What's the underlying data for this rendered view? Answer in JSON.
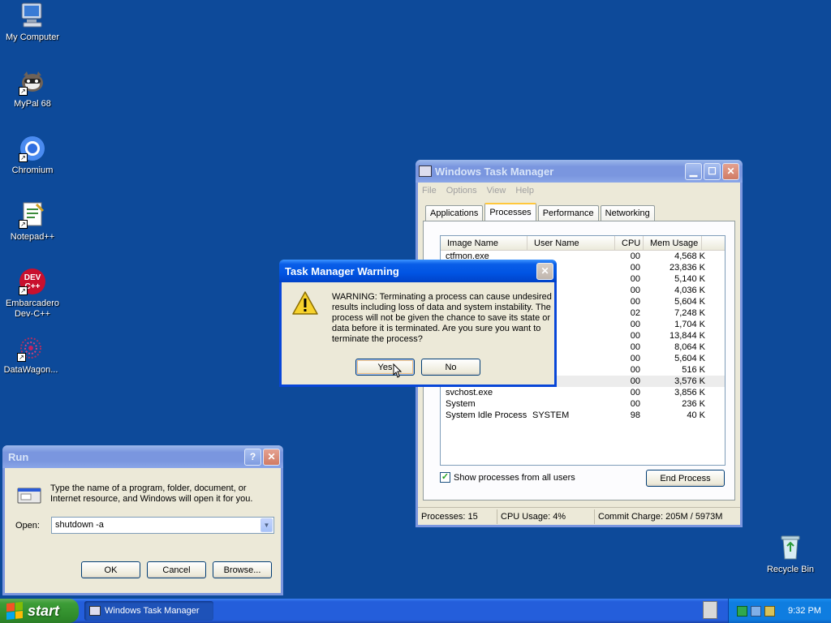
{
  "desktop": {
    "icons": [
      {
        "label": "My Computer"
      },
      {
        "label": "MyPal 68"
      },
      {
        "label": "Chromium"
      },
      {
        "label": "Notepad++"
      },
      {
        "label": "Embarcadero\nDev-C++"
      },
      {
        "label": "DataWagon..."
      },
      {
        "label": "Recycle Bin"
      }
    ]
  },
  "task_manager": {
    "title": "Windows Task Manager",
    "menu": [
      "File",
      "Options",
      "View",
      "Help"
    ],
    "tabs": [
      "Applications",
      "Processes",
      "Performance",
      "Networking"
    ],
    "selected_tab": "Processes",
    "columns": [
      "Image Name",
      "User Name",
      "CPU",
      "Mem Usage"
    ],
    "rows": [
      {
        "name": "ctfmon.exe",
        "user": "",
        "cpu": "00",
        "mem": "4,568 K"
      },
      {
        "name": "",
        "user": "",
        "cpu": "00",
        "mem": "23,836 K"
      },
      {
        "name": "",
        "user": "",
        "cpu": "00",
        "mem": "5,140 K"
      },
      {
        "name": "",
        "user": "",
        "cpu": "00",
        "mem": "4,036 K"
      },
      {
        "name": "",
        "user": "",
        "cpu": "00",
        "mem": "5,604 K"
      },
      {
        "name": "",
        "user": "",
        "cpu": "02",
        "mem": "7,248 K"
      },
      {
        "name": "",
        "user": "",
        "cpu": "00",
        "mem": "1,704 K"
      },
      {
        "name": "",
        "user": "",
        "cpu": "00",
        "mem": "13,844 K"
      },
      {
        "name": "",
        "user": "",
        "cpu": "00",
        "mem": "8,064 K"
      },
      {
        "name": "",
        "user": "",
        "cpu": "00",
        "mem": "5,604 K"
      },
      {
        "name": "",
        "user": "",
        "cpu": "00",
        "mem": "516 K"
      },
      {
        "name": "",
        "user": "",
        "cpu": "00",
        "mem": "3,576 K"
      },
      {
        "name": "svchost.exe",
        "user": "",
        "cpu": "00",
        "mem": "3,856 K"
      },
      {
        "name": "System",
        "user": "",
        "cpu": "00",
        "mem": "236 K"
      },
      {
        "name": "System Idle Process",
        "user": "SYSTEM",
        "cpu": "98",
        "mem": "40 K"
      }
    ],
    "show_all_users_label": "Show processes from all users",
    "show_all_users_checked": true,
    "end_process_label": "End Process",
    "status": {
      "processes": "Processes: 15",
      "cpu": "CPU Usage: 4%",
      "commit": "Commit Charge: 205M / 5973M"
    }
  },
  "warning_dialog": {
    "title": "Task Manager Warning",
    "message": "WARNING: Terminating a process can cause undesired results including loss of data and system instability. The process will not be given the chance to save its state or data before it is terminated.  Are you sure you want to terminate the process?",
    "yes_label": "Yes",
    "no_label": "No"
  },
  "run_dialog": {
    "title": "Run",
    "description": "Type the name of a program, folder, document, or Internet resource, and Windows will open it for you.",
    "open_label": "Open:",
    "open_value": "shutdown -a",
    "ok_label": "OK",
    "cancel_label": "Cancel",
    "browse_label": "Browse..."
  },
  "taskbar": {
    "start_label": "start",
    "task_button": "Windows Task Manager",
    "clock": "9:32 PM"
  }
}
